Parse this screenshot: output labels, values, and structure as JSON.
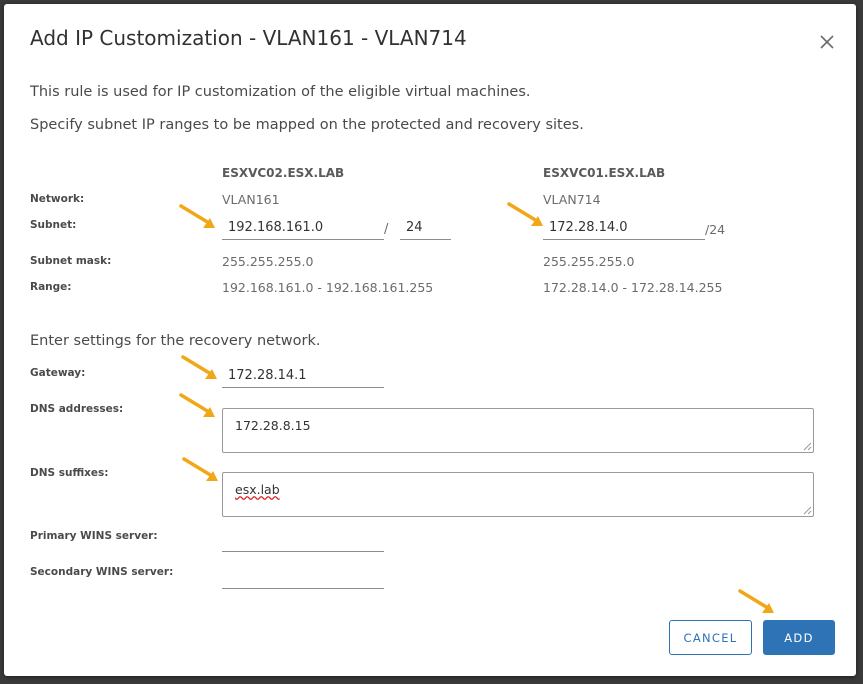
{
  "dialog": {
    "title": "Add IP Customization - VLAN161 - VLAN714",
    "intro_line1": "This rule is used for IP customization of the eligible virtual machines.",
    "intro_line2": "Specify subnet IP ranges to be mapped on the protected and recovery sites.",
    "close_icon": "close-icon"
  },
  "columns": {
    "protected": "ESXVC02.ESX.LAB",
    "recovery": "ESXVC01.ESX.LAB"
  },
  "labels": {
    "network": "Network:",
    "subnet": "Subnet:",
    "subnet_mask": "Subnet mask:",
    "range": "Range:",
    "gateway": "Gateway:",
    "dns_addresses": "DNS addresses:",
    "dns_suffixes": "DNS suffixes:",
    "primary_wins": "Primary WINS server:",
    "secondary_wins": "Secondary WINS server:"
  },
  "protected": {
    "network": "VLAN161",
    "subnet_ip": "192.168.161.0",
    "prefix_separator": "/",
    "prefix": "24",
    "subnet_mask": "255.255.255.0",
    "range": "192.168.161.0 - 192.168.161.255"
  },
  "recovery": {
    "network": "VLAN714",
    "subnet_ip": "172.28.14.0",
    "prefix_text": "/24",
    "subnet_mask": "255.255.255.0",
    "range": "172.28.14.0 - 172.28.14.255"
  },
  "recovery_settings": {
    "heading": "Enter settings for the recovery network.",
    "gateway": "172.28.14.1",
    "dns_addresses": "172.28.8.15",
    "dns_suffixes": "esx.lab",
    "primary_wins": "",
    "secondary_wins": ""
  },
  "buttons": {
    "cancel": "CANCEL",
    "add": "ADD"
  },
  "colors": {
    "accent": "#2e73b5",
    "arrow": "#f0a818"
  }
}
